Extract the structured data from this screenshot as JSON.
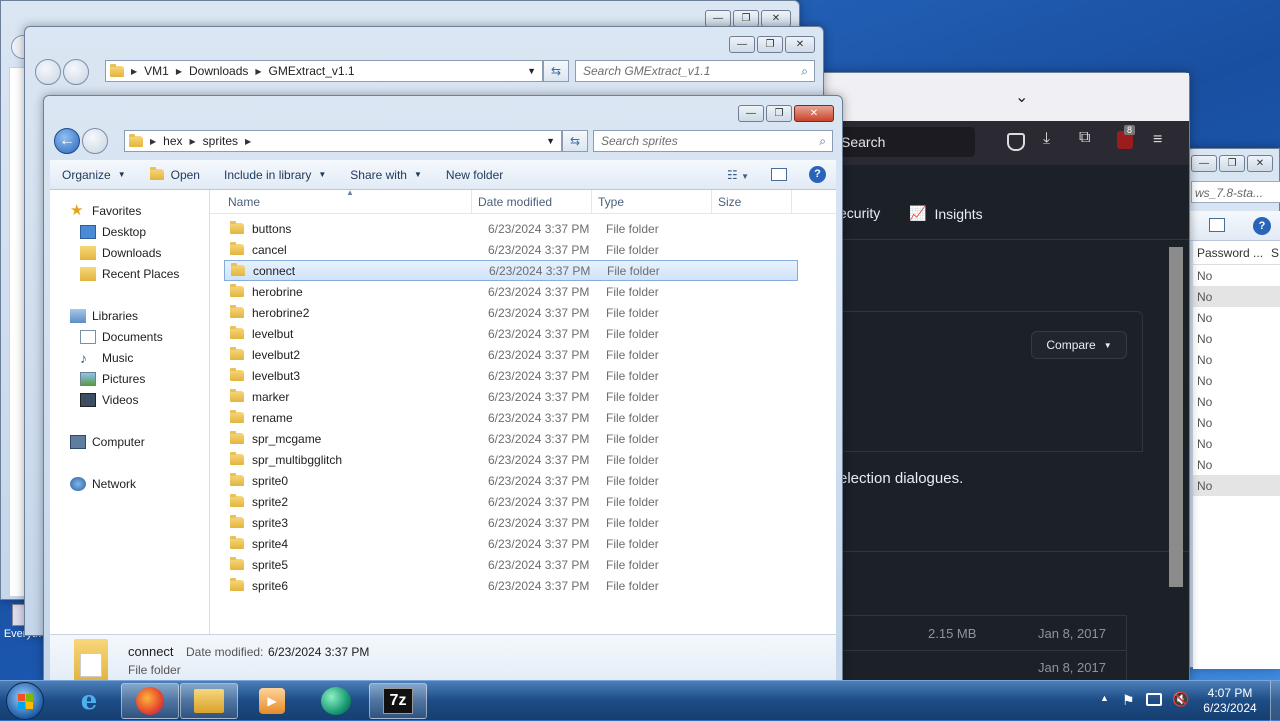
{
  "desktop": {
    "icon_label": "Everyth"
  },
  "back_window_1": {
    "min": "—",
    "max": "❐",
    "close": "✕"
  },
  "gmextract_window": {
    "breadcrumb": [
      "VM1",
      "Downloads",
      "GMExtract_v1.1"
    ],
    "search_placeholder": "Search GMExtract_v1.1",
    "min": "—",
    "max": "❐",
    "close": "✕"
  },
  "browser_window": {
    "search_text": "Search",
    "tab_security": "ecurity",
    "tab_insights": "Insights",
    "badge_count": "8",
    "compare_button": "Compare",
    "description_fragment": "election dialogues.",
    "file_size": "2.15 MB",
    "file_date_1": "Jan 8, 2017",
    "file_date_2": "Jan 8, 2017",
    "min": "—",
    "max": "❐",
    "close": "✕",
    "chevron": "⌄"
  },
  "right_window": {
    "title_fragment": "ws_7.8-sta...",
    "column_header": "Password ...",
    "column_header_2": "S",
    "rows": [
      "No",
      "No",
      "No",
      "No",
      "No",
      "No",
      "No",
      "No",
      "No",
      "No",
      "No"
    ],
    "min": "—",
    "max": "❐",
    "close": "✕"
  },
  "explorer": {
    "breadcrumb": [
      "hex",
      "sprites"
    ],
    "search_placeholder": "Search sprites",
    "toolbar": {
      "organize": "Organize",
      "open": "Open",
      "include_in_library": "Include in library",
      "share_with": "Share with",
      "new_folder": "New folder"
    },
    "nav": {
      "favorites": "Favorites",
      "desktop": "Desktop",
      "downloads": "Downloads",
      "recent_places": "Recent Places",
      "libraries": "Libraries",
      "documents": "Documents",
      "music": "Music",
      "pictures": "Pictures",
      "videos": "Videos",
      "computer": "Computer",
      "network": "Network"
    },
    "columns": {
      "name": "Name",
      "date_modified": "Date modified",
      "type": "Type",
      "size": "Size"
    },
    "files": [
      {
        "name": "buttons",
        "date": "6/23/2024 3:37 PM",
        "type": "File folder"
      },
      {
        "name": "cancel",
        "date": "6/23/2024 3:37 PM",
        "type": "File folder"
      },
      {
        "name": "connect",
        "date": "6/23/2024 3:37 PM",
        "type": "File folder"
      },
      {
        "name": "herobrine",
        "date": "6/23/2024 3:37 PM",
        "type": "File folder"
      },
      {
        "name": "herobrine2",
        "date": "6/23/2024 3:37 PM",
        "type": "File folder"
      },
      {
        "name": "levelbut",
        "date": "6/23/2024 3:37 PM",
        "type": "File folder"
      },
      {
        "name": "levelbut2",
        "date": "6/23/2024 3:37 PM",
        "type": "File folder"
      },
      {
        "name": "levelbut3",
        "date": "6/23/2024 3:37 PM",
        "type": "File folder"
      },
      {
        "name": "marker",
        "date": "6/23/2024 3:37 PM",
        "type": "File folder"
      },
      {
        "name": "rename",
        "date": "6/23/2024 3:37 PM",
        "type": "File folder"
      },
      {
        "name": "spr_mcgame",
        "date": "6/23/2024 3:37 PM",
        "type": "File folder"
      },
      {
        "name": "spr_multibgglitch",
        "date": "6/23/2024 3:37 PM",
        "type": "File folder"
      },
      {
        "name": "sprite0",
        "date": "6/23/2024 3:37 PM",
        "type": "File folder"
      },
      {
        "name": "sprite2",
        "date": "6/23/2024 3:37 PM",
        "type": "File folder"
      },
      {
        "name": "sprite3",
        "date": "6/23/2024 3:37 PM",
        "type": "File folder"
      },
      {
        "name": "sprite4",
        "date": "6/23/2024 3:37 PM",
        "type": "File folder"
      },
      {
        "name": "sprite5",
        "date": "6/23/2024 3:37 PM",
        "type": "File folder"
      },
      {
        "name": "sprite6",
        "date": "6/23/2024 3:37 PM",
        "type": "File folder"
      }
    ],
    "selected_index": 2,
    "details": {
      "name": "connect",
      "date_label": "Date modified:",
      "date_value": "6/23/2024 3:37 PM",
      "type": "File folder"
    },
    "min": "—",
    "max": "❐",
    "close": "✕"
  },
  "taskbar": {
    "time": "4:07 PM",
    "date": "6/23/2024",
    "app_7z_label": "7z",
    "tray_up": "▲"
  }
}
